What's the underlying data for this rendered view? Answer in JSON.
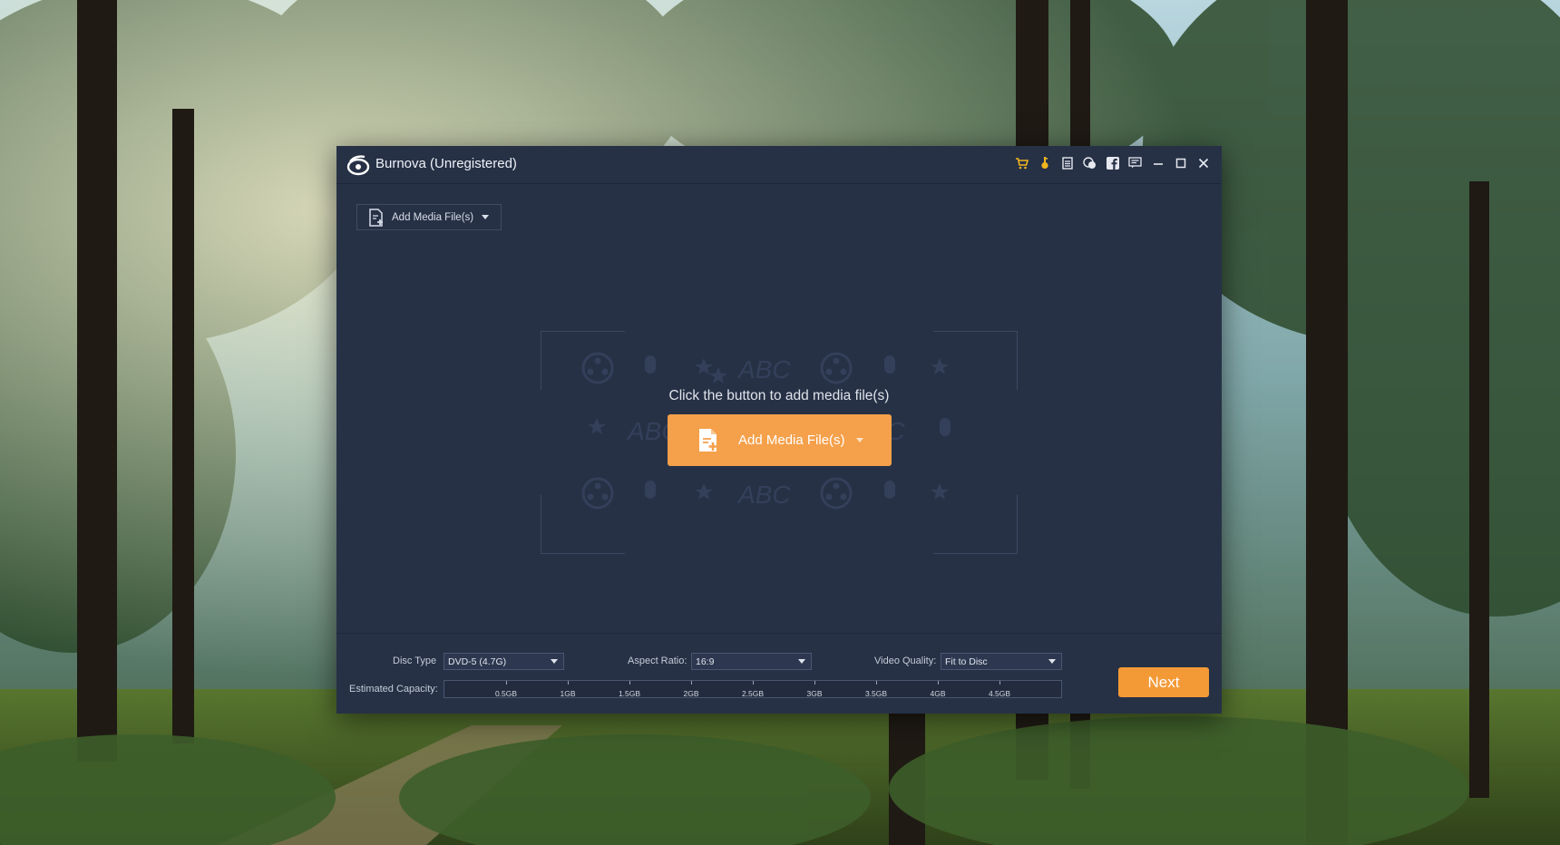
{
  "window": {
    "title": "Burnova (Unregistered)",
    "titlebar_icons": [
      "cart-icon",
      "key-icon",
      "document-icon",
      "feedback-icon",
      "facebook-icon",
      "menu-icon",
      "minimize-icon",
      "maximize-icon",
      "close-icon"
    ]
  },
  "toolbar": {
    "add_media_label": "Add Media File(s)"
  },
  "drop_zone": {
    "hint": "Click the button to add media file(s)",
    "button_label": "Add Media File(s)",
    "watermark_text": "ABC"
  },
  "bottom": {
    "disc_type_label": "Disc Type",
    "disc_type_value": "DVD-5 (4.7G)",
    "aspect_ratio_label": "Aspect Ratio:",
    "aspect_ratio_value": "16:9",
    "video_quality_label": "Video Quality:",
    "video_quality_value": "Fit to Disc",
    "capacity_label": "Estimated Capacity:",
    "capacity_ticks": [
      "0.5GB",
      "1GB",
      "1.5GB",
      "2GB",
      "2.5GB",
      "3GB",
      "3.5GB",
      "4GB",
      "4.5GB"
    ],
    "next_label": "Next"
  },
  "colors": {
    "window_bg": "#263146",
    "accent_orange": "#f5a04a",
    "next_orange": "#f39a37",
    "icon_yellow": "#f2b51f"
  }
}
